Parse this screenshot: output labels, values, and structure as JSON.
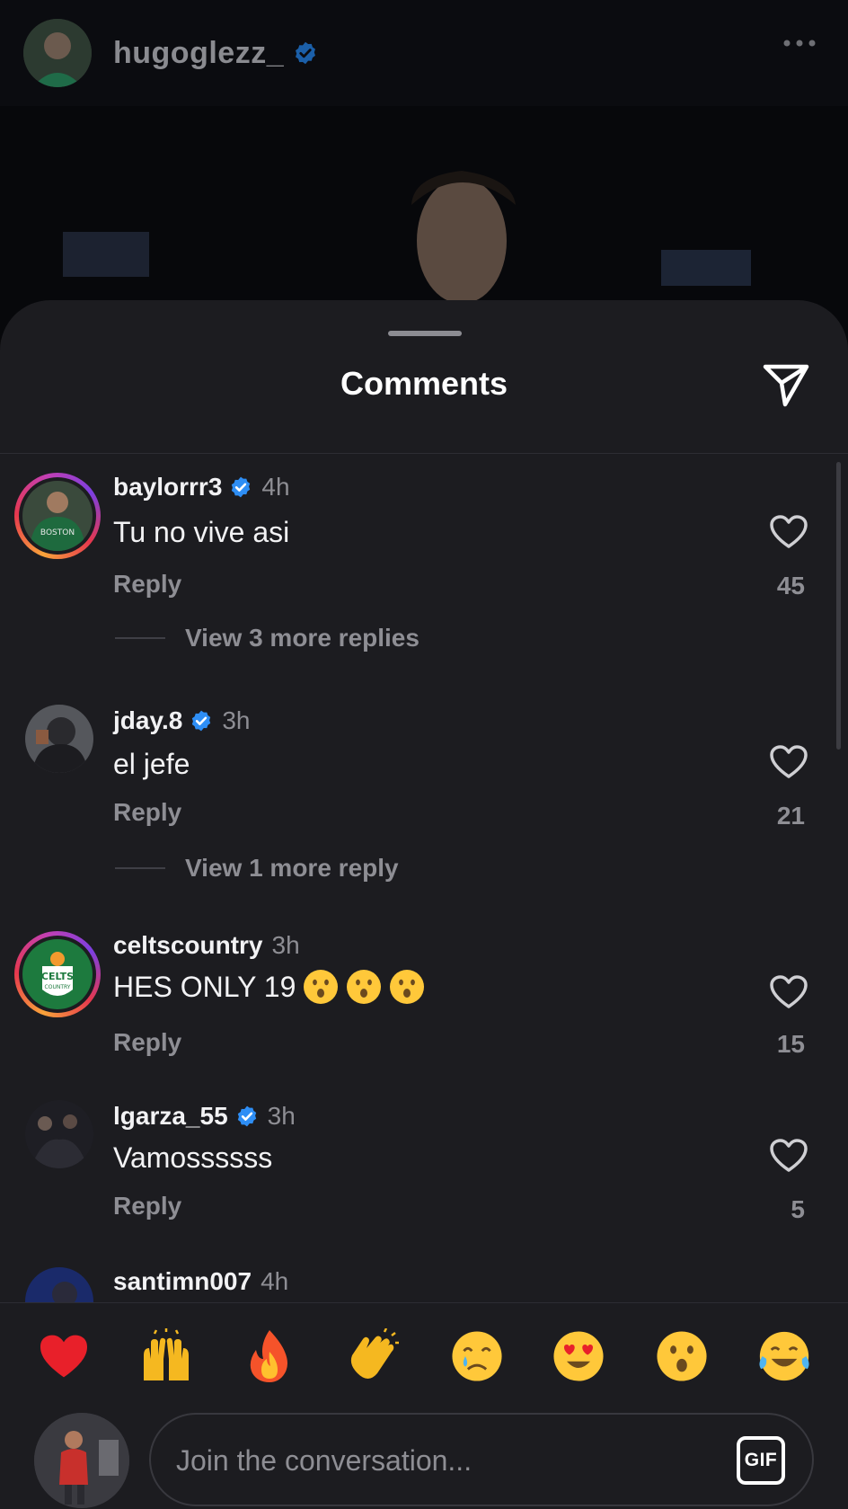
{
  "post": {
    "username": "hugoglezz_"
  },
  "sheet": {
    "title": "Comments"
  },
  "comments": [
    {
      "username": "baylorrr3",
      "verified": true,
      "time": "4h",
      "text": "Tu no vive asi",
      "reply_label": "Reply",
      "likes": "45",
      "more_replies": "View 3 more replies"
    },
    {
      "username": "jday.8",
      "verified": true,
      "time": "3h",
      "text": "el jefe",
      "reply_label": "Reply",
      "likes": "21",
      "more_replies": "View 1 more reply"
    },
    {
      "username": "celtscountry",
      "verified": false,
      "time": "3h",
      "text": "HES ONLY 19",
      "text_emojis": [
        "hushed-face",
        "hushed-face",
        "hushed-face"
      ],
      "reply_label": "Reply",
      "likes": "15"
    },
    {
      "username": "lgarza_55",
      "verified": true,
      "time": "3h",
      "text": "Vamossssss",
      "reply_label": "Reply",
      "likes": "5"
    },
    {
      "username": "santimn007",
      "verified": false,
      "time": "4h"
    }
  ],
  "emoji_bar": [
    "red-heart",
    "raising-hands",
    "fire",
    "clapping-hands",
    "crying-face",
    "heart-eyes",
    "hushed-face",
    "tears-of-joy"
  ],
  "composer": {
    "placeholder": "Join the conversation...",
    "gif_label": "GIF"
  },
  "colors": {
    "sheet_bg": "#1c1c20",
    "verified_blue": "#2e8ef5",
    "muted_text": "#8e8e94"
  }
}
